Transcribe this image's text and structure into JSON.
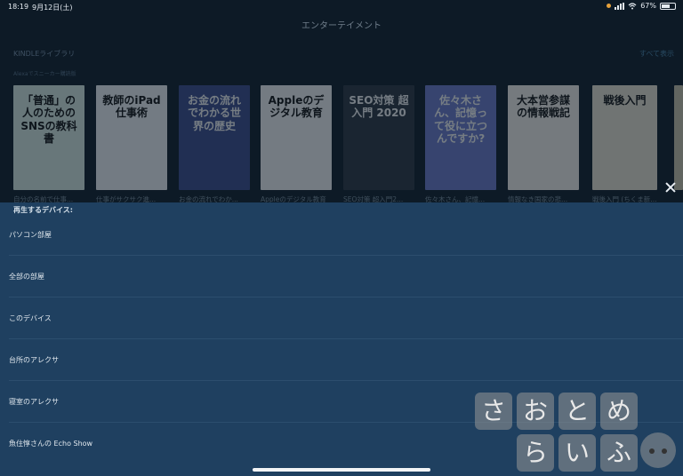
{
  "status_bar": {
    "time": "18:19",
    "date": "9月12日(土)",
    "battery": "67%",
    "battery_level": 0.67
  },
  "header": {
    "title": "エンターテイメント"
  },
  "library": {
    "title": "KINDLEライブラリ",
    "see_all": "すべて表示",
    "subtitle": "Alexaでスニーカー購読版",
    "books": [
      {
        "cover_text": "「普通」の人のための SNSの教科書",
        "caption": "自分の名前で仕事...",
        "cover_color": "#d6e8e0"
      },
      {
        "cover_text": "教師のiPad仕事術",
        "caption": "仕事がサクサク進...",
        "cover_color": "#f0f2f5"
      },
      {
        "cover_text": "お金の流れでわかる世界の歴史",
        "caption": "お金の流れでわか...",
        "cover_color": "#3a4a8a"
      },
      {
        "cover_text": "Appleのデジタル教育",
        "caption": "Appleのデジタル教育",
        "cover_color": "#f2f2f2"
      },
      {
        "cover_text": "SEO対策 超入門 2020",
        "caption": "SEO対策 超入門2...",
        "cover_color": "#2a3440"
      },
      {
        "cover_text": "佐々木さん、記憶って役に立つんですか?",
        "caption": "佐々木さん、記憶...",
        "cover_color": "#6a78c8"
      },
      {
        "cover_text": "大本営参謀の情報戦記",
        "caption": "情報なき国家の悲...",
        "cover_color": "#f4f0ea"
      },
      {
        "cover_text": "戦後入門",
        "caption": "戦後入門 (ちくま新...",
        "cover_color": "#e8e2d2"
      },
      {
        "cover_text": "",
        "caption": "",
        "cover_color": "#c8c0a8"
      }
    ]
  },
  "sheet": {
    "title": "再生するデバイス:",
    "devices": [
      "パソコン部屋",
      "全部の部屋",
      "このデバイス",
      "台所のアレクサ",
      "寝室のアレクサ",
      "魚住惇さんの Echo Show"
    ]
  },
  "watermark": {
    "row1": [
      "さ",
      "お",
      "と",
      "め"
    ],
    "row2": [
      "ら",
      "い",
      "ふ"
    ]
  }
}
